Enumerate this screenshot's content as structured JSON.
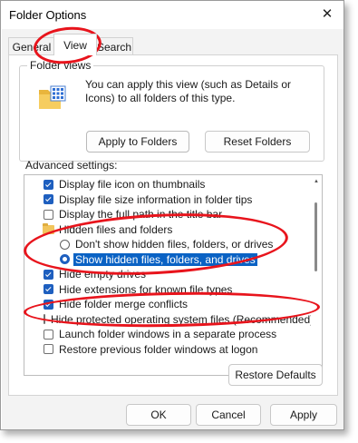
{
  "window": {
    "title": "Folder Options",
    "close_glyph": "✕"
  },
  "tabs": [
    {
      "label": "General",
      "active": false
    },
    {
      "label": "View",
      "active": true
    },
    {
      "label": "Search",
      "active": false
    }
  ],
  "folder_views": {
    "title": "Folder views",
    "description": "You can apply this view (such as Details or Icons) to all folders of this type.",
    "icon": "folder-icon",
    "apply_button": "Apply to Folders",
    "reset_button": "Reset Folders"
  },
  "advanced": {
    "label": "Advanced settings:",
    "items": [
      {
        "type": "checkbox",
        "checked": true,
        "text": "Display file icon on thumbnails"
      },
      {
        "type": "checkbox",
        "checked": true,
        "text": "Display file size information in folder tips"
      },
      {
        "type": "checkbox",
        "checked": false,
        "text": "Display the full path in the title bar"
      },
      {
        "type": "folder",
        "text": "Hidden files and folders"
      },
      {
        "type": "radio",
        "selected": false,
        "text": "Don't show hidden files, folders, or drives"
      },
      {
        "type": "radio",
        "selected": true,
        "text": "Show hidden files, folders, and drives",
        "highlighted": true
      },
      {
        "type": "checkbox",
        "checked": true,
        "text": "Hide empty drives"
      },
      {
        "type": "checkbox",
        "checked": true,
        "text": "Hide extensions for known file types"
      },
      {
        "type": "checkbox",
        "checked": true,
        "text": "Hide folder merge conflicts"
      },
      {
        "type": "checkbox",
        "checked": false,
        "text": "Hide protected operating system files (Recommended)"
      },
      {
        "type": "checkbox",
        "checked": false,
        "text": "Launch folder windows in a separate process"
      },
      {
        "type": "checkbox",
        "checked": false,
        "text": "Restore previous folder windows at logon"
      }
    ]
  },
  "buttons": {
    "restore_defaults": "Restore Defaults",
    "ok": "OK",
    "cancel": "Cancel",
    "apply": "Apply"
  },
  "colors": {
    "accent": "#1e5fbf",
    "highlight": "#0a62c4",
    "annotation": "#e8141c"
  }
}
